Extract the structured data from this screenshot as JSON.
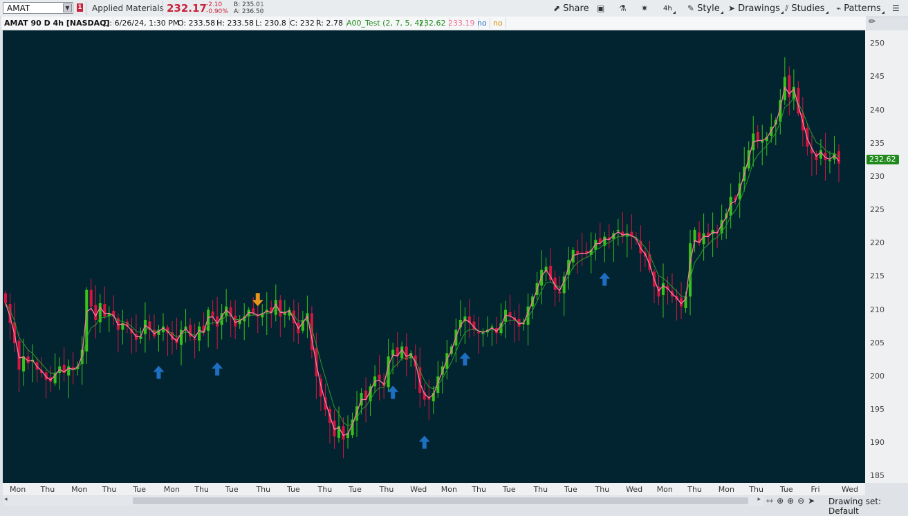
{
  "toolbar": {
    "symbol": "AMAT",
    "alert_badge": "1",
    "company_name": "Applied Materials",
    "last_price": "232.17",
    "change": "-2.10",
    "change_pct": "-0.90%",
    "bid": "B: 235.01",
    "ask": "A: 236.50",
    "share_label": "Share",
    "style_label": "Style",
    "drawings_label": "Drawings",
    "studies_label": "Studies",
    "patterns_label": "Patterns",
    "timeframe_label": "4h"
  },
  "infobar": {
    "title": "AMAT 90 D 4h [NASDAQ]",
    "date": "D: 6/26/24, 1:30 PM",
    "open": "O: 233.58",
    "high": "H: 233.58",
    "low": "L: 230.8",
    "close": "C: 232",
    "range": "R: 2.78",
    "study": "A00_Test (2, 7, 5, 4)",
    "study_val1": "232.62",
    "study_val2": "233.19",
    "flag1": "no",
    "flag2": "no"
  },
  "price_tag": "232.62",
  "colors": {
    "bg": "#022431",
    "up": "#39c21a",
    "down": "#d5153f",
    "fast": "#ff7aa0",
    "slow": "#2f9a2a",
    "buy": "#1e6fc2",
    "sell": "#e8941a"
  },
  "chart_data": {
    "type": "candlestick",
    "title": "AMAT 90 D 4h [NASDAQ]",
    "ylim": [
      184,
      252
    ],
    "yticks": [
      185,
      190,
      195,
      200,
      205,
      210,
      215,
      220,
      225,
      230,
      235,
      240,
      245,
      250
    ],
    "xticks": [
      "Mon",
      "Thu",
      "Mon",
      "Thu",
      "Tue",
      "Mon",
      "Thu",
      "Tue",
      "Thu",
      "Tue",
      "Thu",
      "Tue",
      "Thu",
      "Wed",
      "Mon",
      "Thu",
      "Tue",
      "Thu",
      "Tue",
      "Thu",
      "Wed",
      "Mon",
      "Thu",
      "Mon",
      "Thu",
      "Tue",
      "Fri",
      "Wed"
    ],
    "closes": [
      211,
      208,
      205,
      201,
      203,
      202,
      202.5,
      201,
      200.5,
      199.5,
      199.2,
      200.5,
      201.5,
      200.5,
      201.5,
      201,
      201.5,
      204,
      213,
      210.5,
      208.5,
      211,
      209,
      209.5,
      209,
      207,
      208,
      207.5,
      206.5,
      205.5,
      206,
      208.5,
      207,
      206,
      207,
      207.5,
      206.5,
      205.5,
      205,
      207,
      207.5,
      206,
      205.5,
      207.5,
      206.5,
      210,
      209,
      207.5,
      209.5,
      210.5,
      209,
      207.5,
      208.5,
      209,
      210,
      209.5,
      209,
      209.5,
      210,
      209.5,
      211.5,
      209,
      209.5,
      210,
      208,
      206.5,
      208.5,
      209.5,
      204,
      200,
      197,
      195,
      193,
      191,
      192.5,
      190.5,
      191.5,
      193.5,
      195.5,
      197.5,
      196.5,
      198.5,
      200,
      199.5,
      198.5,
      203,
      204,
      203,
      204.5,
      202.5,
      203.5,
      201.5,
      197.5,
      196.5,
      196.5,
      197.5,
      200,
      201.5,
      203.5,
      204.5,
      207,
      208.5,
      209,
      208,
      207,
      206.5,
      206.5,
      207,
      207.5,
      206.5,
      208,
      210,
      209,
      208.5,
      207.5,
      208,
      210.5,
      212,
      214,
      216,
      216.5,
      214.5,
      213,
      212.5,
      215,
      217.5,
      219,
      218.5,
      218.5,
      218.5,
      219,
      220.5,
      220,
      221,
      220.5,
      221.5,
      222,
      221,
      221.5,
      221,
      220.5,
      218.5,
      218,
      216,
      213.5,
      212,
      214,
      213,
      212,
      211.5,
      210.5,
      212,
      220,
      222,
      220,
      221.5,
      221,
      222,
      221.5,
      223.5,
      224.5,
      227,
      226.5,
      229,
      231.5,
      234,
      236.5,
      235.5,
      235.5,
      236,
      237.5,
      238.5,
      241.5,
      245,
      242,
      243.5,
      239.5,
      237,
      234.5,
      233.5,
      232.5,
      234,
      232.5,
      232.5,
      233.5,
      232
    ],
    "markers": [
      {
        "type": "buy",
        "bar": 34
      },
      {
        "type": "buy",
        "bar": 47
      },
      {
        "type": "sell",
        "bar": 56
      },
      {
        "type": "buy",
        "bar": 86
      },
      {
        "type": "buy",
        "bar": 93
      },
      {
        "type": "buy",
        "bar": 102
      },
      {
        "type": "buy",
        "bar": 133
      }
    ],
    "last_value": 232.62
  },
  "bottom": {
    "drawing_set": "Drawing set: Default"
  }
}
